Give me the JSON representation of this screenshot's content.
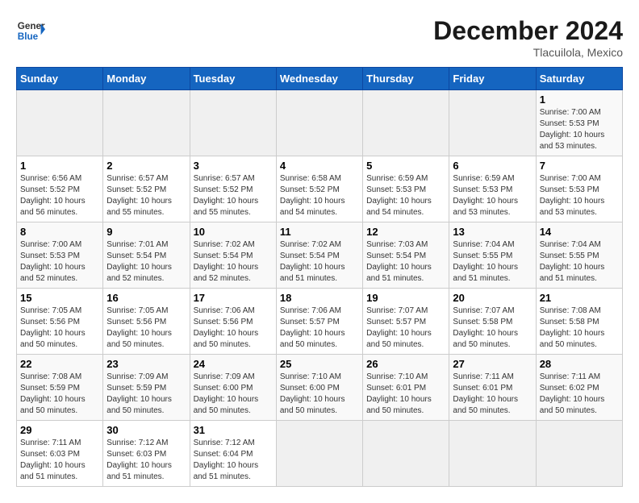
{
  "header": {
    "logo_general": "General",
    "logo_blue": "Blue",
    "month_title": "December 2024",
    "location": "Tlacuilola, Mexico"
  },
  "calendar": {
    "days_of_week": [
      "Sunday",
      "Monday",
      "Tuesday",
      "Wednesday",
      "Thursday",
      "Friday",
      "Saturday"
    ],
    "weeks": [
      [
        {
          "day": "",
          "empty": true
        },
        {
          "day": "",
          "empty": true
        },
        {
          "day": "",
          "empty": true
        },
        {
          "day": "",
          "empty": true
        },
        {
          "day": "",
          "empty": true
        },
        {
          "day": "",
          "empty": true
        },
        {
          "day": "1",
          "sunrise": "Sunrise: 7:00 AM",
          "sunset": "Sunset: 5:53 PM",
          "daylight": "Daylight: 10 hours and 53 minutes."
        }
      ],
      [
        {
          "day": "1",
          "sunrise": "Sunrise: 6:56 AM",
          "sunset": "Sunset: 5:52 PM",
          "daylight": "Daylight: 10 hours and 56 minutes."
        },
        {
          "day": "2",
          "sunrise": "Sunrise: 6:57 AM",
          "sunset": "Sunset: 5:52 PM",
          "daylight": "Daylight: 10 hours and 55 minutes."
        },
        {
          "day": "3",
          "sunrise": "Sunrise: 6:57 AM",
          "sunset": "Sunset: 5:52 PM",
          "daylight": "Daylight: 10 hours and 55 minutes."
        },
        {
          "day": "4",
          "sunrise": "Sunrise: 6:58 AM",
          "sunset": "Sunset: 5:52 PM",
          "daylight": "Daylight: 10 hours and 54 minutes."
        },
        {
          "day": "5",
          "sunrise": "Sunrise: 6:59 AM",
          "sunset": "Sunset: 5:53 PM",
          "daylight": "Daylight: 10 hours and 54 minutes."
        },
        {
          "day": "6",
          "sunrise": "Sunrise: 6:59 AM",
          "sunset": "Sunset: 5:53 PM",
          "daylight": "Daylight: 10 hours and 53 minutes."
        },
        {
          "day": "7",
          "sunrise": "Sunrise: 7:00 AM",
          "sunset": "Sunset: 5:53 PM",
          "daylight": "Daylight: 10 hours and 53 minutes."
        }
      ],
      [
        {
          "day": "8",
          "sunrise": "Sunrise: 7:00 AM",
          "sunset": "Sunset: 5:53 PM",
          "daylight": "Daylight: 10 hours and 52 minutes."
        },
        {
          "day": "9",
          "sunrise": "Sunrise: 7:01 AM",
          "sunset": "Sunset: 5:54 PM",
          "daylight": "Daylight: 10 hours and 52 minutes."
        },
        {
          "day": "10",
          "sunrise": "Sunrise: 7:02 AM",
          "sunset": "Sunset: 5:54 PM",
          "daylight": "Daylight: 10 hours and 52 minutes."
        },
        {
          "day": "11",
          "sunrise": "Sunrise: 7:02 AM",
          "sunset": "Sunset: 5:54 PM",
          "daylight": "Daylight: 10 hours and 51 minutes."
        },
        {
          "day": "12",
          "sunrise": "Sunrise: 7:03 AM",
          "sunset": "Sunset: 5:54 PM",
          "daylight": "Daylight: 10 hours and 51 minutes."
        },
        {
          "day": "13",
          "sunrise": "Sunrise: 7:04 AM",
          "sunset": "Sunset: 5:55 PM",
          "daylight": "Daylight: 10 hours and 51 minutes."
        },
        {
          "day": "14",
          "sunrise": "Sunrise: 7:04 AM",
          "sunset": "Sunset: 5:55 PM",
          "daylight": "Daylight: 10 hours and 51 minutes."
        }
      ],
      [
        {
          "day": "15",
          "sunrise": "Sunrise: 7:05 AM",
          "sunset": "Sunset: 5:56 PM",
          "daylight": "Daylight: 10 hours and 50 minutes."
        },
        {
          "day": "16",
          "sunrise": "Sunrise: 7:05 AM",
          "sunset": "Sunset: 5:56 PM",
          "daylight": "Daylight: 10 hours and 50 minutes."
        },
        {
          "day": "17",
          "sunrise": "Sunrise: 7:06 AM",
          "sunset": "Sunset: 5:56 PM",
          "daylight": "Daylight: 10 hours and 50 minutes."
        },
        {
          "day": "18",
          "sunrise": "Sunrise: 7:06 AM",
          "sunset": "Sunset: 5:57 PM",
          "daylight": "Daylight: 10 hours and 50 minutes."
        },
        {
          "day": "19",
          "sunrise": "Sunrise: 7:07 AM",
          "sunset": "Sunset: 5:57 PM",
          "daylight": "Daylight: 10 hours and 50 minutes."
        },
        {
          "day": "20",
          "sunrise": "Sunrise: 7:07 AM",
          "sunset": "Sunset: 5:58 PM",
          "daylight": "Daylight: 10 hours and 50 minutes."
        },
        {
          "day": "21",
          "sunrise": "Sunrise: 7:08 AM",
          "sunset": "Sunset: 5:58 PM",
          "daylight": "Daylight: 10 hours and 50 minutes."
        }
      ],
      [
        {
          "day": "22",
          "sunrise": "Sunrise: 7:08 AM",
          "sunset": "Sunset: 5:59 PM",
          "daylight": "Daylight: 10 hours and 50 minutes."
        },
        {
          "day": "23",
          "sunrise": "Sunrise: 7:09 AM",
          "sunset": "Sunset: 5:59 PM",
          "daylight": "Daylight: 10 hours and 50 minutes."
        },
        {
          "day": "24",
          "sunrise": "Sunrise: 7:09 AM",
          "sunset": "Sunset: 6:00 PM",
          "daylight": "Daylight: 10 hours and 50 minutes."
        },
        {
          "day": "25",
          "sunrise": "Sunrise: 7:10 AM",
          "sunset": "Sunset: 6:00 PM",
          "daylight": "Daylight: 10 hours and 50 minutes."
        },
        {
          "day": "26",
          "sunrise": "Sunrise: 7:10 AM",
          "sunset": "Sunset: 6:01 PM",
          "daylight": "Daylight: 10 hours and 50 minutes."
        },
        {
          "day": "27",
          "sunrise": "Sunrise: 7:11 AM",
          "sunset": "Sunset: 6:01 PM",
          "daylight": "Daylight: 10 hours and 50 minutes."
        },
        {
          "day": "28",
          "sunrise": "Sunrise: 7:11 AM",
          "sunset": "Sunset: 6:02 PM",
          "daylight": "Daylight: 10 hours and 50 minutes."
        }
      ],
      [
        {
          "day": "29",
          "sunrise": "Sunrise: 7:11 AM",
          "sunset": "Sunset: 6:03 PM",
          "daylight": "Daylight: 10 hours and 51 minutes."
        },
        {
          "day": "30",
          "sunrise": "Sunrise: 7:12 AM",
          "sunset": "Sunset: 6:03 PM",
          "daylight": "Daylight: 10 hours and 51 minutes."
        },
        {
          "day": "31",
          "sunrise": "Sunrise: 7:12 AM",
          "sunset": "Sunset: 6:04 PM",
          "daylight": "Daylight: 10 hours and 51 minutes."
        },
        {
          "day": "",
          "empty": true
        },
        {
          "day": "",
          "empty": true
        },
        {
          "day": "",
          "empty": true
        },
        {
          "day": "",
          "empty": true
        }
      ]
    ]
  }
}
